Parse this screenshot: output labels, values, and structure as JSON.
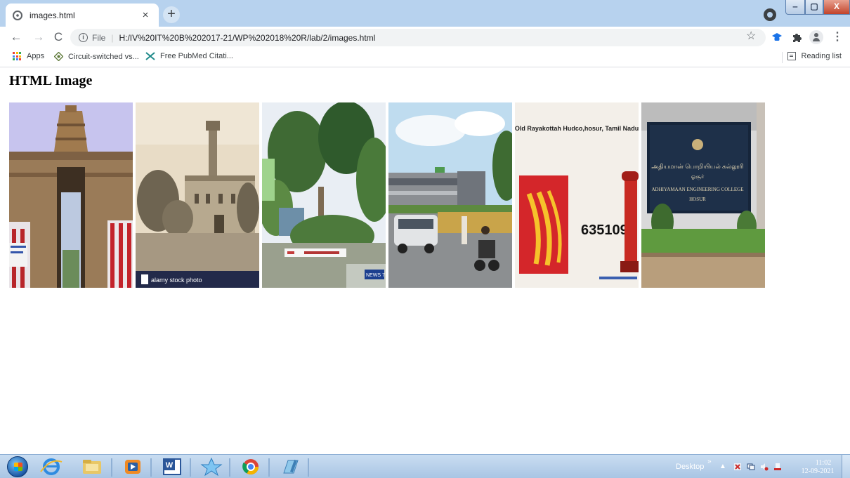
{
  "browser": {
    "tab_title": "images.html",
    "tab_close": "×",
    "new_tab": "+",
    "window_min": "‒",
    "window_max": "▢",
    "window_close": "X",
    "nav_back": "←",
    "nav_forward": "→",
    "nav_reload": "C",
    "info_glyph": "i",
    "scheme_label": "File",
    "separator": "|",
    "url": "H:/IV%20IT%20B%202017-21/WP%202018%20R/lab/2/images.html",
    "star": "☆",
    "menu": "⋮"
  },
  "bookmarks": {
    "items": [
      {
        "label": "Apps",
        "icon": "apps-grid-icon"
      },
      {
        "label": "Circuit-switched vs...",
        "icon": "circuit-icon"
      },
      {
        "label": "Free PubMed Citati...",
        "icon": "pubmed-icon"
      }
    ],
    "reading_list": "Reading list"
  },
  "page": {
    "heading": "HTML Image",
    "images": [
      {
        "subject": "temple-gopuram"
      },
      {
        "subject": "vintage-palace",
        "watermark": "alamy stock photo"
      },
      {
        "subject": "town-square",
        "sign": "NEWS 7"
      },
      {
        "subject": "street-road"
      },
      {
        "subject": "post-office",
        "title": "Old Rayakottah Hudco,hosur, Tamil Nadu",
        "pincode": "635109"
      },
      {
        "subject": "college-entrance",
        "line1": "அதியமான் பொறியியல் கல்லூரி",
        "line2": "ஓசூர்",
        "line3": "ADHIYAMAAN ENGINEERING COLLEGE",
        "line4": "HOSUR"
      }
    ]
  },
  "taskbar": {
    "desktop_label": "Desktop",
    "chevron": "»",
    "up_arrow": "▲",
    "time": "11:02",
    "date": "12-09-2021"
  },
  "colors": {
    "tabstrip": "#b7d2ee",
    "omnibox": "#f1f3f4",
    "taskbar": "#a9c5e4"
  }
}
